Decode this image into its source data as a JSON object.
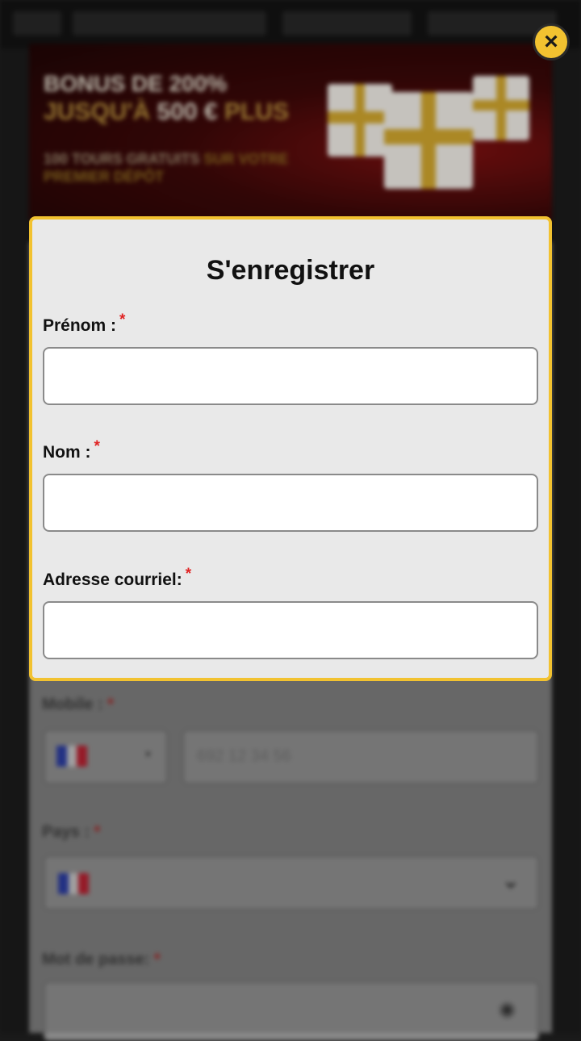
{
  "banner": {
    "line1": "BONUS DE 200%",
    "line2_gold": "JUSQU'À",
    "line2_white": "500 €",
    "line2_gold2": "PLUS",
    "line3_white": "100 TOURS GRATUITS",
    "line3_gold": "SUR VOTRE PREMIER DÉPÔT"
  },
  "close_label": "×",
  "form": {
    "title": "S'enregistrer",
    "required_mark": "*",
    "fields": [
      {
        "label": "Prénom :",
        "value": ""
      },
      {
        "label": "Nom :",
        "value": ""
      },
      {
        "label": "Adresse courriel:",
        "value": ""
      }
    ]
  },
  "background_form": {
    "mobile_label": "Mobile :",
    "mobile_placeholder": "692 12 34 56",
    "country_label": "Pays :",
    "password_label": "Mot de passe:"
  },
  "colors": {
    "accent": "#f2c230",
    "required": "#e02424",
    "panel_bg": "#e9e9e9"
  },
  "icons": [
    "close-icon",
    "chevron-down-icon",
    "eye-icon",
    "france-flag-icon",
    "gift-icon"
  ]
}
